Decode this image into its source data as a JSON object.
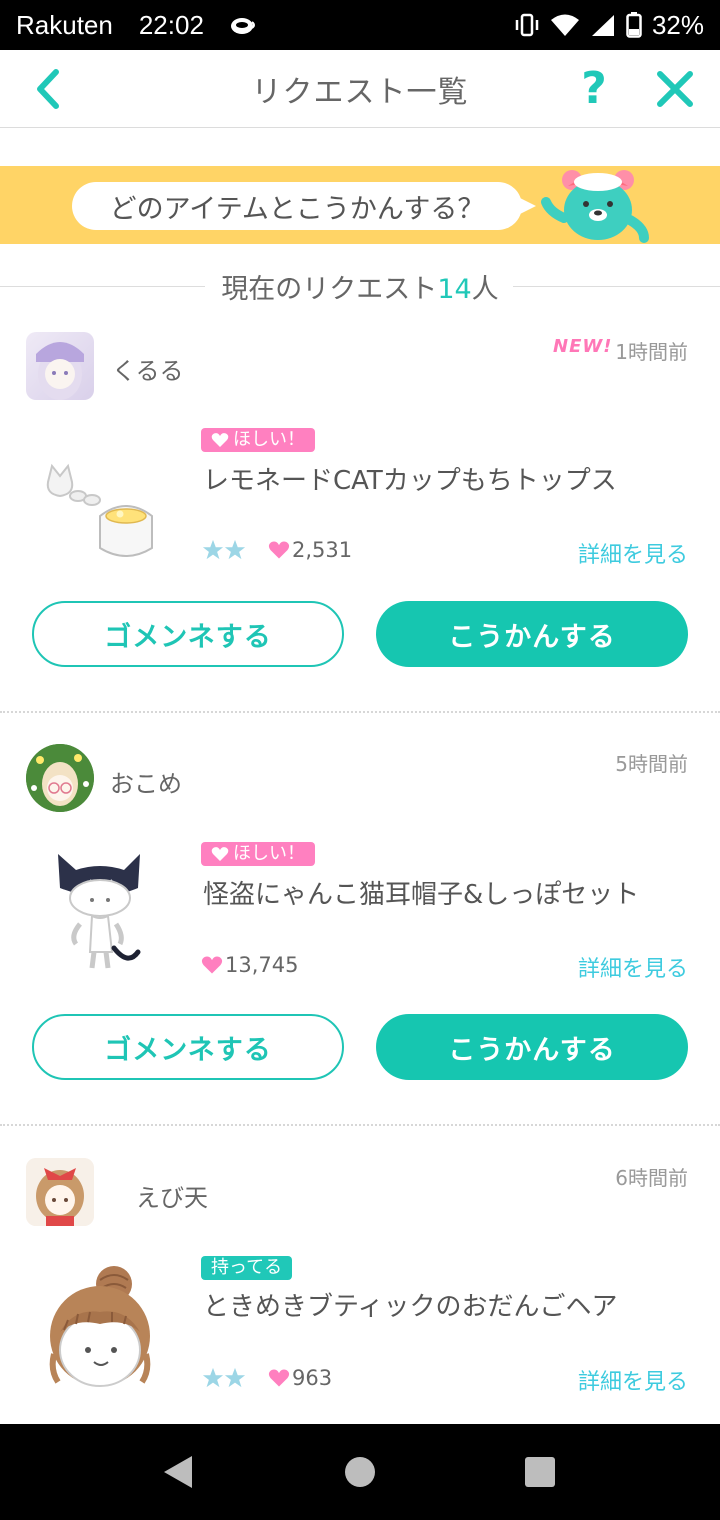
{
  "status_bar": {
    "carrier": "Rakuten",
    "time": "22:02",
    "battery": "32%"
  },
  "header": {
    "title": "リクエスト一覧",
    "help": "?"
  },
  "banner": {
    "question": "どのアイテムとこうかんする？"
  },
  "requests_heading": {
    "label": "現在のリクエスト",
    "count": "14",
    "unit": "人"
  },
  "requests": [
    {
      "user": "くるる",
      "new_badge": "NEW!",
      "time": "1時間前",
      "tag": "ほしい！",
      "item": "レモネードCATカップもちトップス",
      "stars": 2,
      "likes": "2,531",
      "detail": "詳細を見る",
      "decline": "ゴメンネする",
      "accept": "こうかんする"
    },
    {
      "user": "おこめ",
      "time": "5時間前",
      "tag": "ほしい！",
      "item": "怪盗にゃんこ猫耳帽子&しっぽセット",
      "stars": 0,
      "likes": "13,745",
      "detail": "詳細を見る",
      "decline": "ゴメンネする",
      "accept": "こうかんする"
    },
    {
      "user": "えび天",
      "time": "6時間前",
      "tag": "持ってる",
      "item": "ときめきブティックのおだんごヘア",
      "stars": 2,
      "likes": "963",
      "detail": "詳細を見る"
    }
  ],
  "colors": {
    "accent": "#16c6b0",
    "pink": "#ff80c0",
    "banner": "#ffd466",
    "link": "#3ecbdf"
  }
}
